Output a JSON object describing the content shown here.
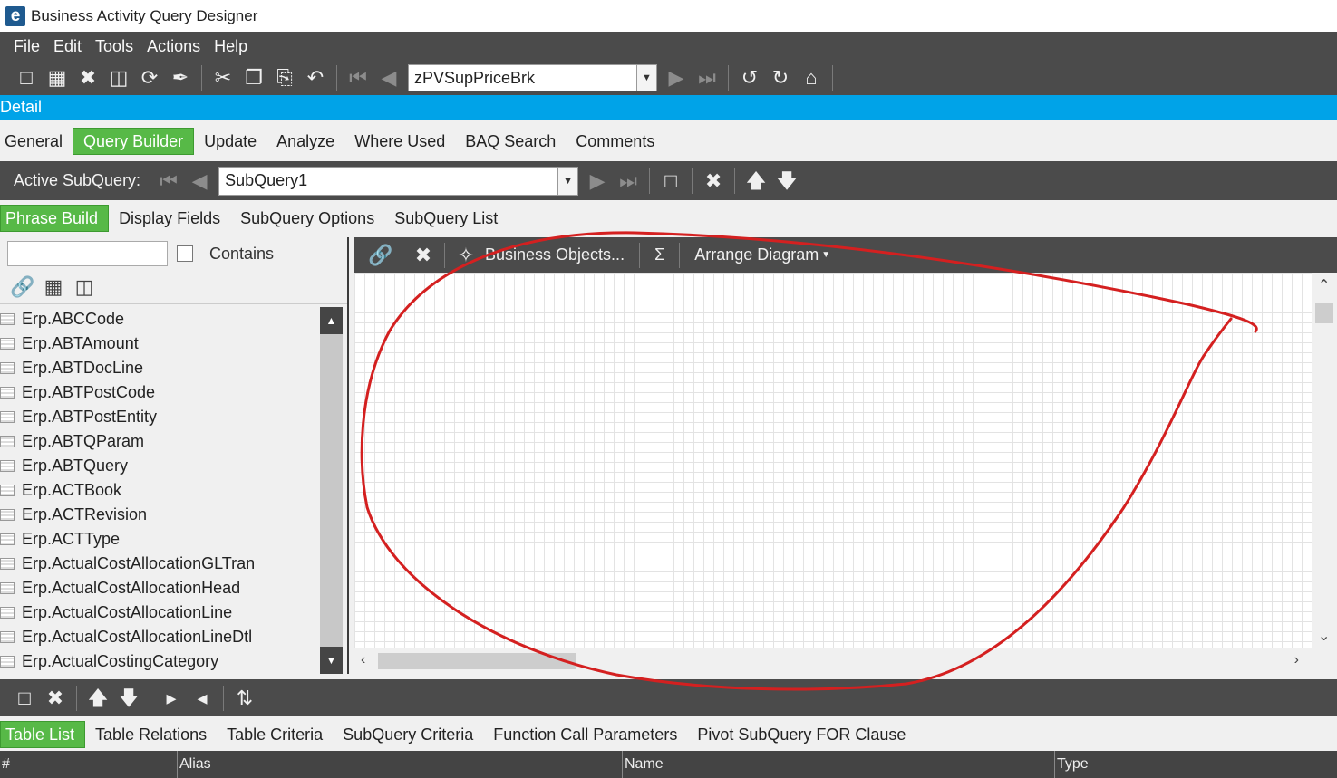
{
  "window": {
    "title": "Business Activity Query Designer",
    "logo_letter": "e"
  },
  "menu": [
    "File",
    "Edit",
    "Tools",
    "Actions",
    "Help"
  ],
  "main_toolbar": {
    "query_combo_value": "zPVSupPriceBrk"
  },
  "detail_bar": {
    "label": "Detail"
  },
  "main_tabs": [
    "General",
    "Query Builder",
    "Update",
    "Analyze",
    "Where Used",
    "BAQ Search",
    "Comments"
  ],
  "main_tabs_active": "Query Builder",
  "subquery_bar": {
    "label": "Active SubQuery:",
    "value": "SubQuery1"
  },
  "sub_tabs": [
    "Phrase Build",
    "Display Fields",
    "SubQuery Options",
    "SubQuery List"
  ],
  "sub_tabs_active": "Phrase Build",
  "left_panel": {
    "filter_value": "",
    "contains_label": "Contains",
    "tables": [
      "Erp.ABCCode",
      "Erp.ABTAmount",
      "Erp.ABTDocLine",
      "Erp.ABTPostCode",
      "Erp.ABTPostEntity",
      "Erp.ABTQParam",
      "Erp.ABTQuery",
      "Erp.ACTBook",
      "Erp.ACTRevision",
      "Erp.ACTType",
      "Erp.ActualCostAllocationGLTran",
      "Erp.ActualCostAllocationHead",
      "Erp.ActualCostAllocationLine",
      "Erp.ActualCostAllocationLineDtl",
      "Erp.ActualCostingCategory"
    ]
  },
  "diagram_toolbar": {
    "business_objects": "Business Objects...",
    "sigma": "Σ",
    "arrange": "Arrange Diagram"
  },
  "bottom_tabs": [
    "Table List",
    "Table Relations",
    "Table Criteria",
    "SubQuery Criteria",
    "Function Call Parameters",
    "Pivot SubQuery FOR Clause"
  ],
  "bottom_tabs_active": "Table List",
  "grid_columns": [
    "#",
    "Alias",
    "Name",
    "Type"
  ],
  "colors": {
    "accent": "#00a3e8",
    "active_tab": "#57b947",
    "toolbar": "#4b4b4b",
    "annotation": "#d42020"
  },
  "icons": [
    "new-icon",
    "save-icon",
    "delete-icon",
    "clear-icon",
    "refresh-icon",
    "paint-icon",
    "cut-icon",
    "copy-icon",
    "paste-icon",
    "undo-icon",
    "first-icon",
    "prev-icon",
    "next-icon",
    "last-icon",
    "back-icon",
    "forward-icon",
    "home-icon"
  ]
}
